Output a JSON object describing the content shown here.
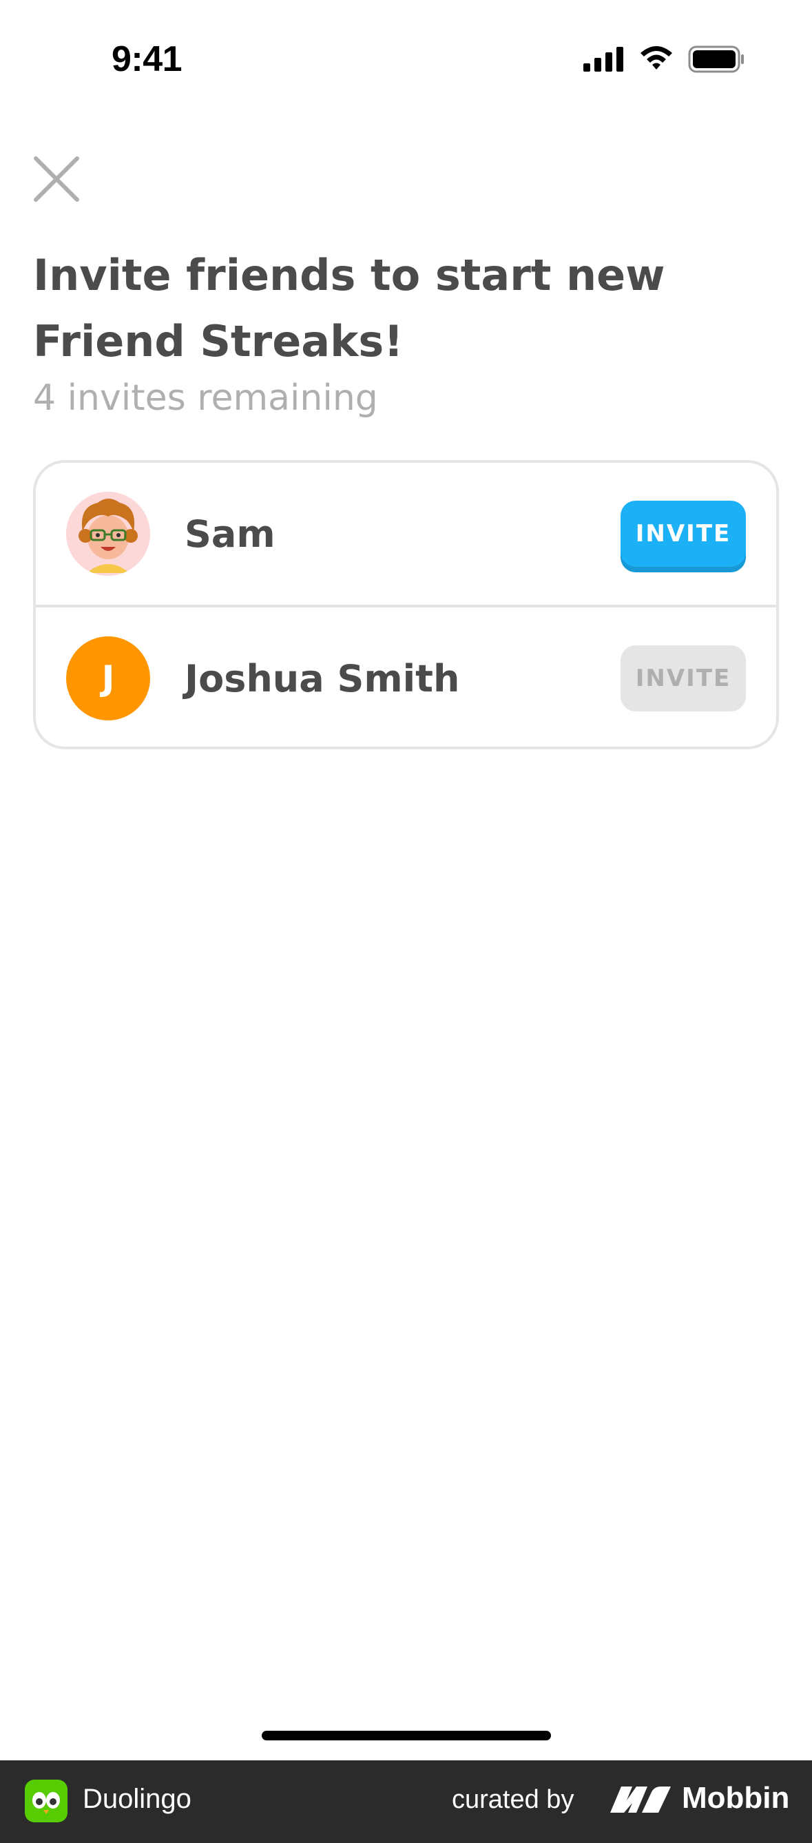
{
  "status_bar": {
    "time": "9:41",
    "icons": [
      "cellular-signal-icon",
      "wifi-icon",
      "battery-icon"
    ]
  },
  "header": {
    "close_icon": "close-icon",
    "title": "Invite friends to start new Friend Streaks!",
    "subtitle": "4 invites remaining"
  },
  "friends": [
    {
      "name": "Sam",
      "avatar": "character-avatar",
      "button_label": "INVITE",
      "button_enabled": true
    },
    {
      "name": "Joshua Smith",
      "avatar_letter": "J",
      "button_label": "INVITE",
      "button_enabled": false
    }
  ],
  "colors": {
    "invite_active": "#1cb0f6",
    "invite_disabled": "#e5e5e5",
    "avatar_orange": "#ff9600",
    "text_primary": "#4b4b4b",
    "text_muted": "#afafaf"
  },
  "footer": {
    "app_name": "Duolingo",
    "curated_by": "curated by",
    "brand": "Mobbin"
  }
}
